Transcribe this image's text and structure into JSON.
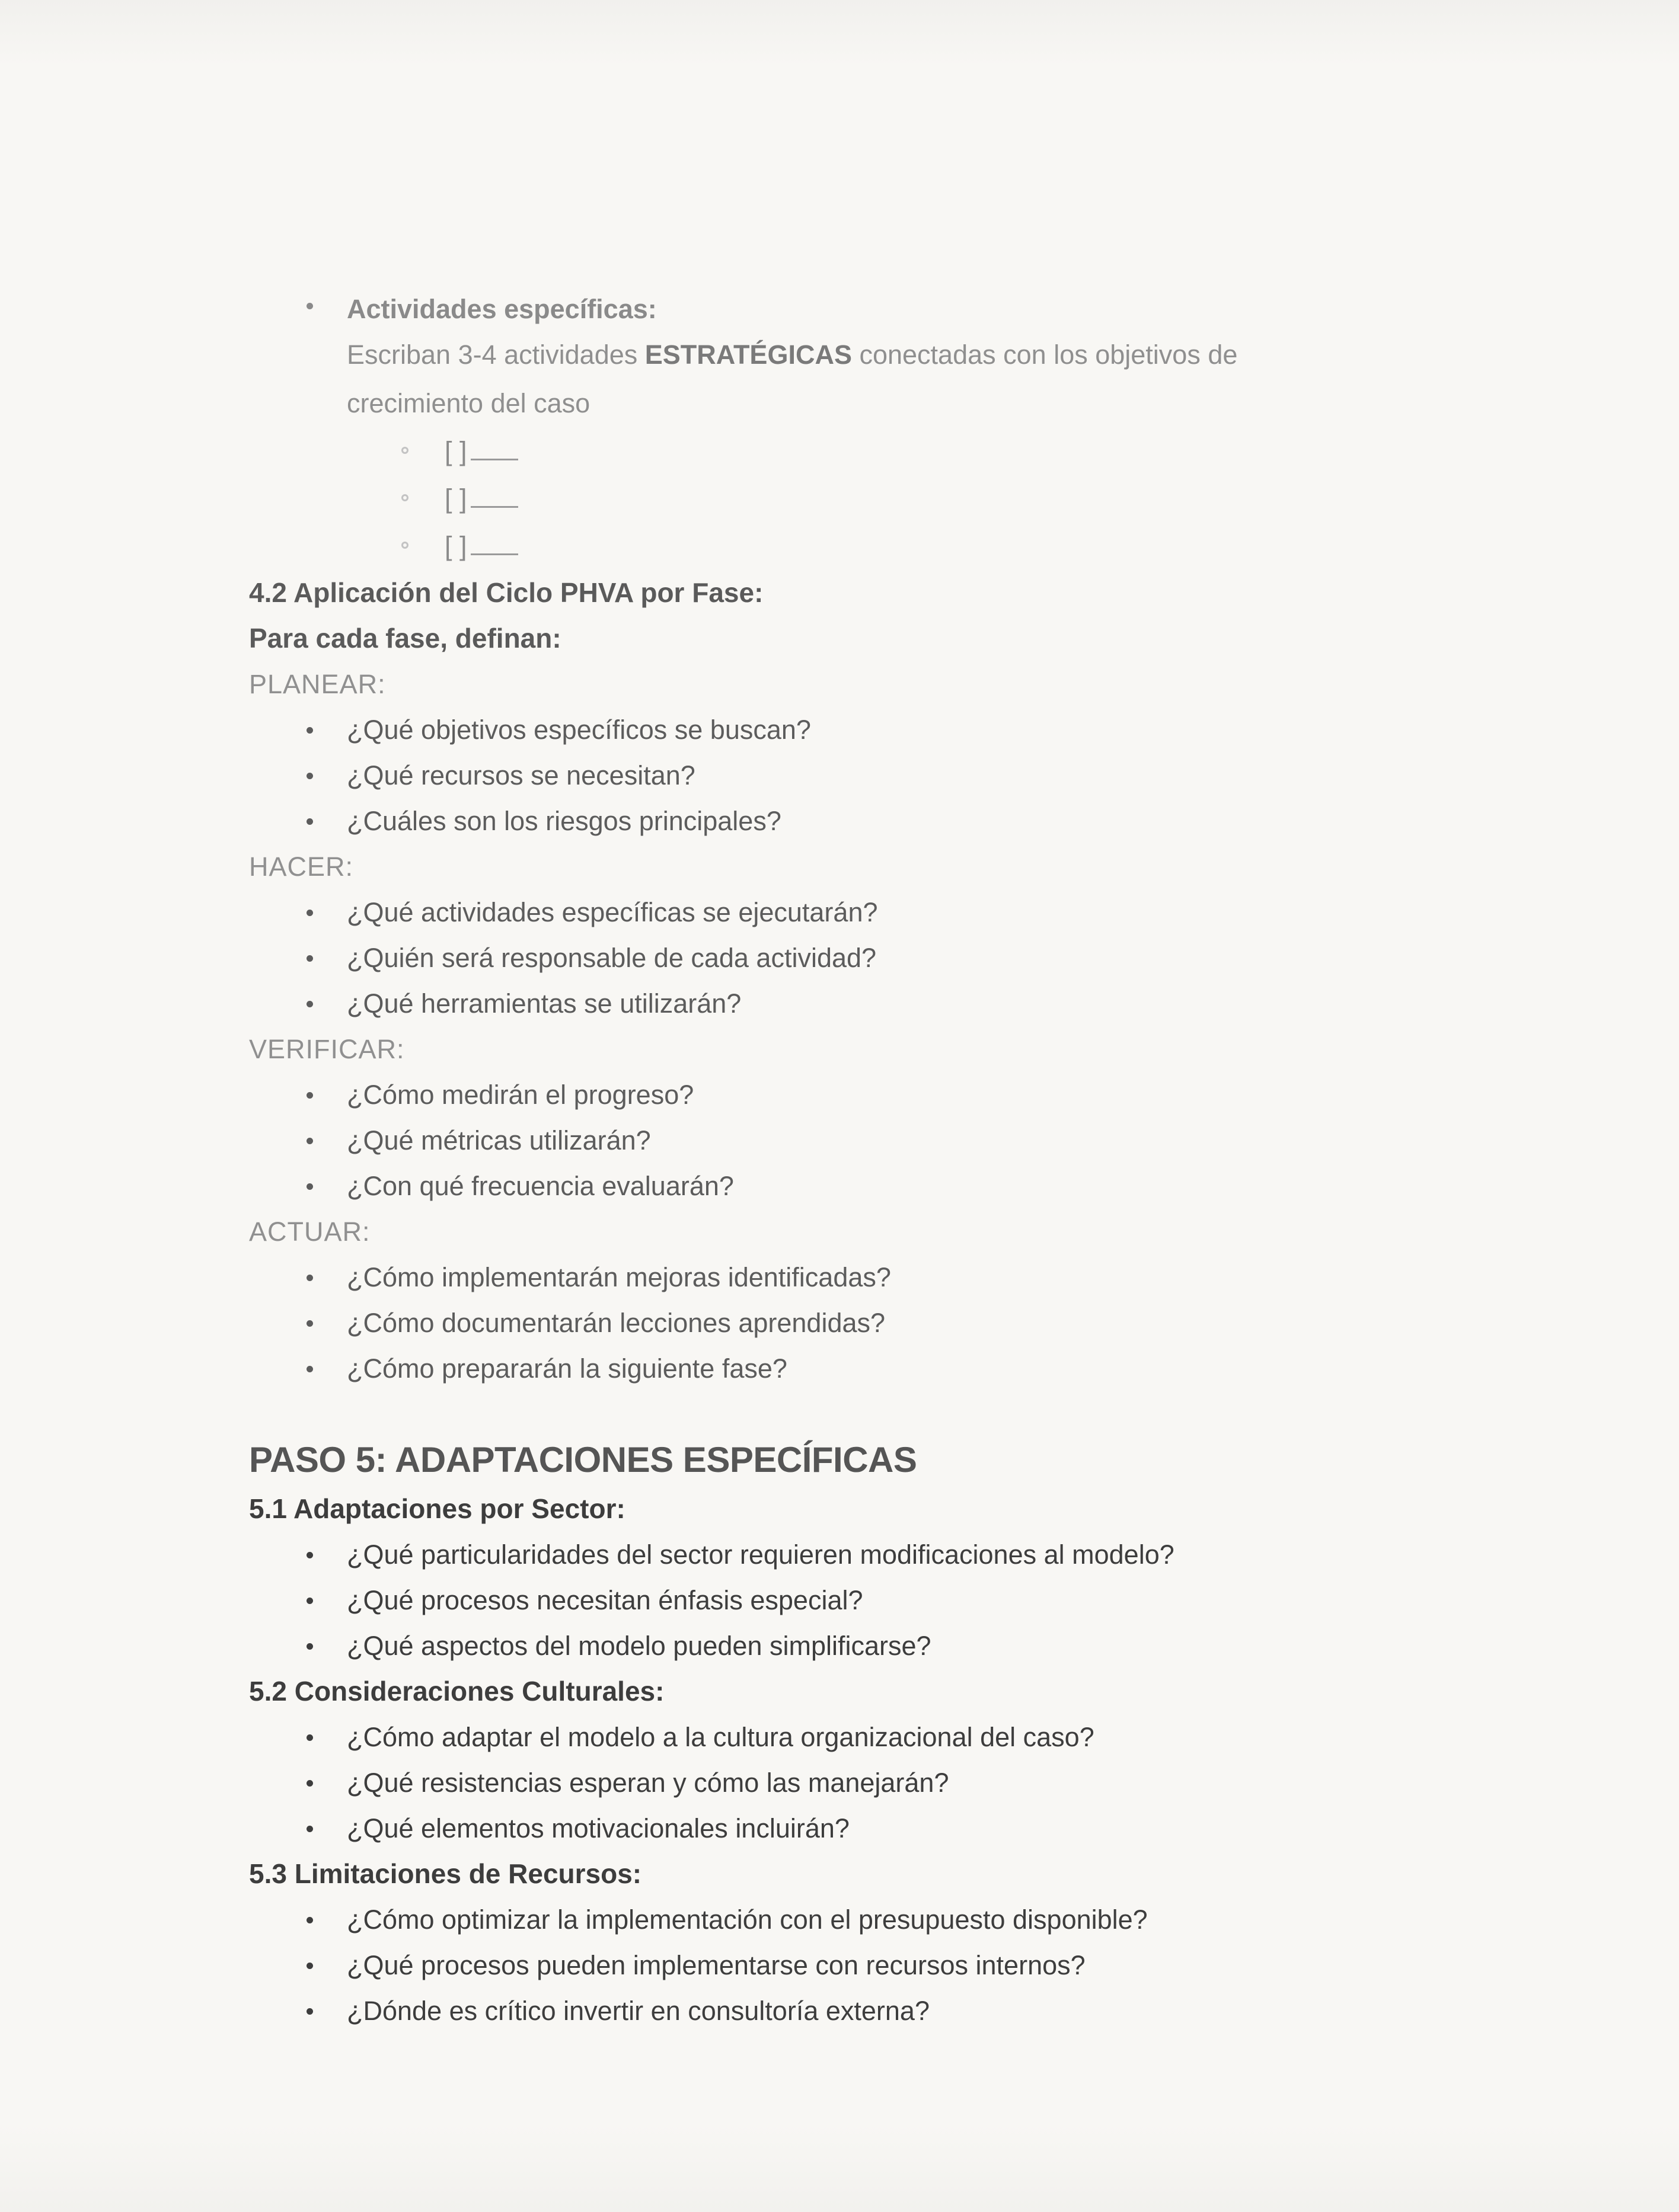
{
  "activities": {
    "title": "Actividades específicas:",
    "desc_pre": "Escriban 3-4 actividades ",
    "desc_bold": "ESTRATÉGICAS",
    "desc_post": " conectadas con los objetivos de",
    "desc_line2": "crecimiento del caso",
    "checkbox_label": "[ ]",
    "checkbox_items": [
      "",
      "",
      ""
    ]
  },
  "section4_2": {
    "title": "4.2 Aplicación del Ciclo PHVA por Fase:",
    "intro": "Para cada fase, definan:",
    "phases": [
      {
        "label": "PLANEAR:",
        "questions": [
          "¿Qué objetivos específicos se buscan?",
          "¿Qué recursos se necesitan?",
          "¿Cuáles son los riesgos principales?"
        ]
      },
      {
        "label": "HACER:",
        "questions": [
          "¿Qué actividades específicas se ejecutarán?",
          "¿Quién será responsable de cada actividad?",
          "¿Qué herramientas se utilizarán?"
        ]
      },
      {
        "label": "VERIFICAR:",
        "questions": [
          "¿Cómo medirán el progreso?",
          "¿Qué métricas utilizarán?",
          "¿Con qué frecuencia evaluarán?"
        ]
      },
      {
        "label": "ACTUAR:",
        "questions": [
          "¿Cómo implementarán mejoras identificadas?",
          "¿Cómo documentarán lecciones aprendidas?",
          "¿Cómo prepararán la siguiente fase?"
        ]
      }
    ]
  },
  "paso5": {
    "title": "PASO 5: ADAPTACIONES ESPECÍFICAS",
    "subsections": [
      {
        "title": "5.1 Adaptaciones por Sector:",
        "questions": [
          "¿Qué particularidades del sector requieren modificaciones al modelo?",
          "¿Qué procesos necesitan énfasis especial?",
          "¿Qué aspectos del modelo pueden simplificarse?"
        ]
      },
      {
        "title": "5.2 Consideraciones Culturales:",
        "questions": [
          "¿Cómo adaptar el modelo a la cultura organizacional del caso?",
          "¿Qué resistencias esperan y cómo las manejarán?",
          "¿Qué elementos motivacionales incluirán?"
        ]
      },
      {
        "title": "5.3 Limitaciones de Recursos:",
        "questions": [
          "¿Cómo optimizar la implementación con el presupuesto disponible?",
          "¿Qué procesos pueden implementarse con recursos internos?",
          "¿Dónde es crítico invertir en consultoría externa?"
        ]
      }
    ]
  }
}
